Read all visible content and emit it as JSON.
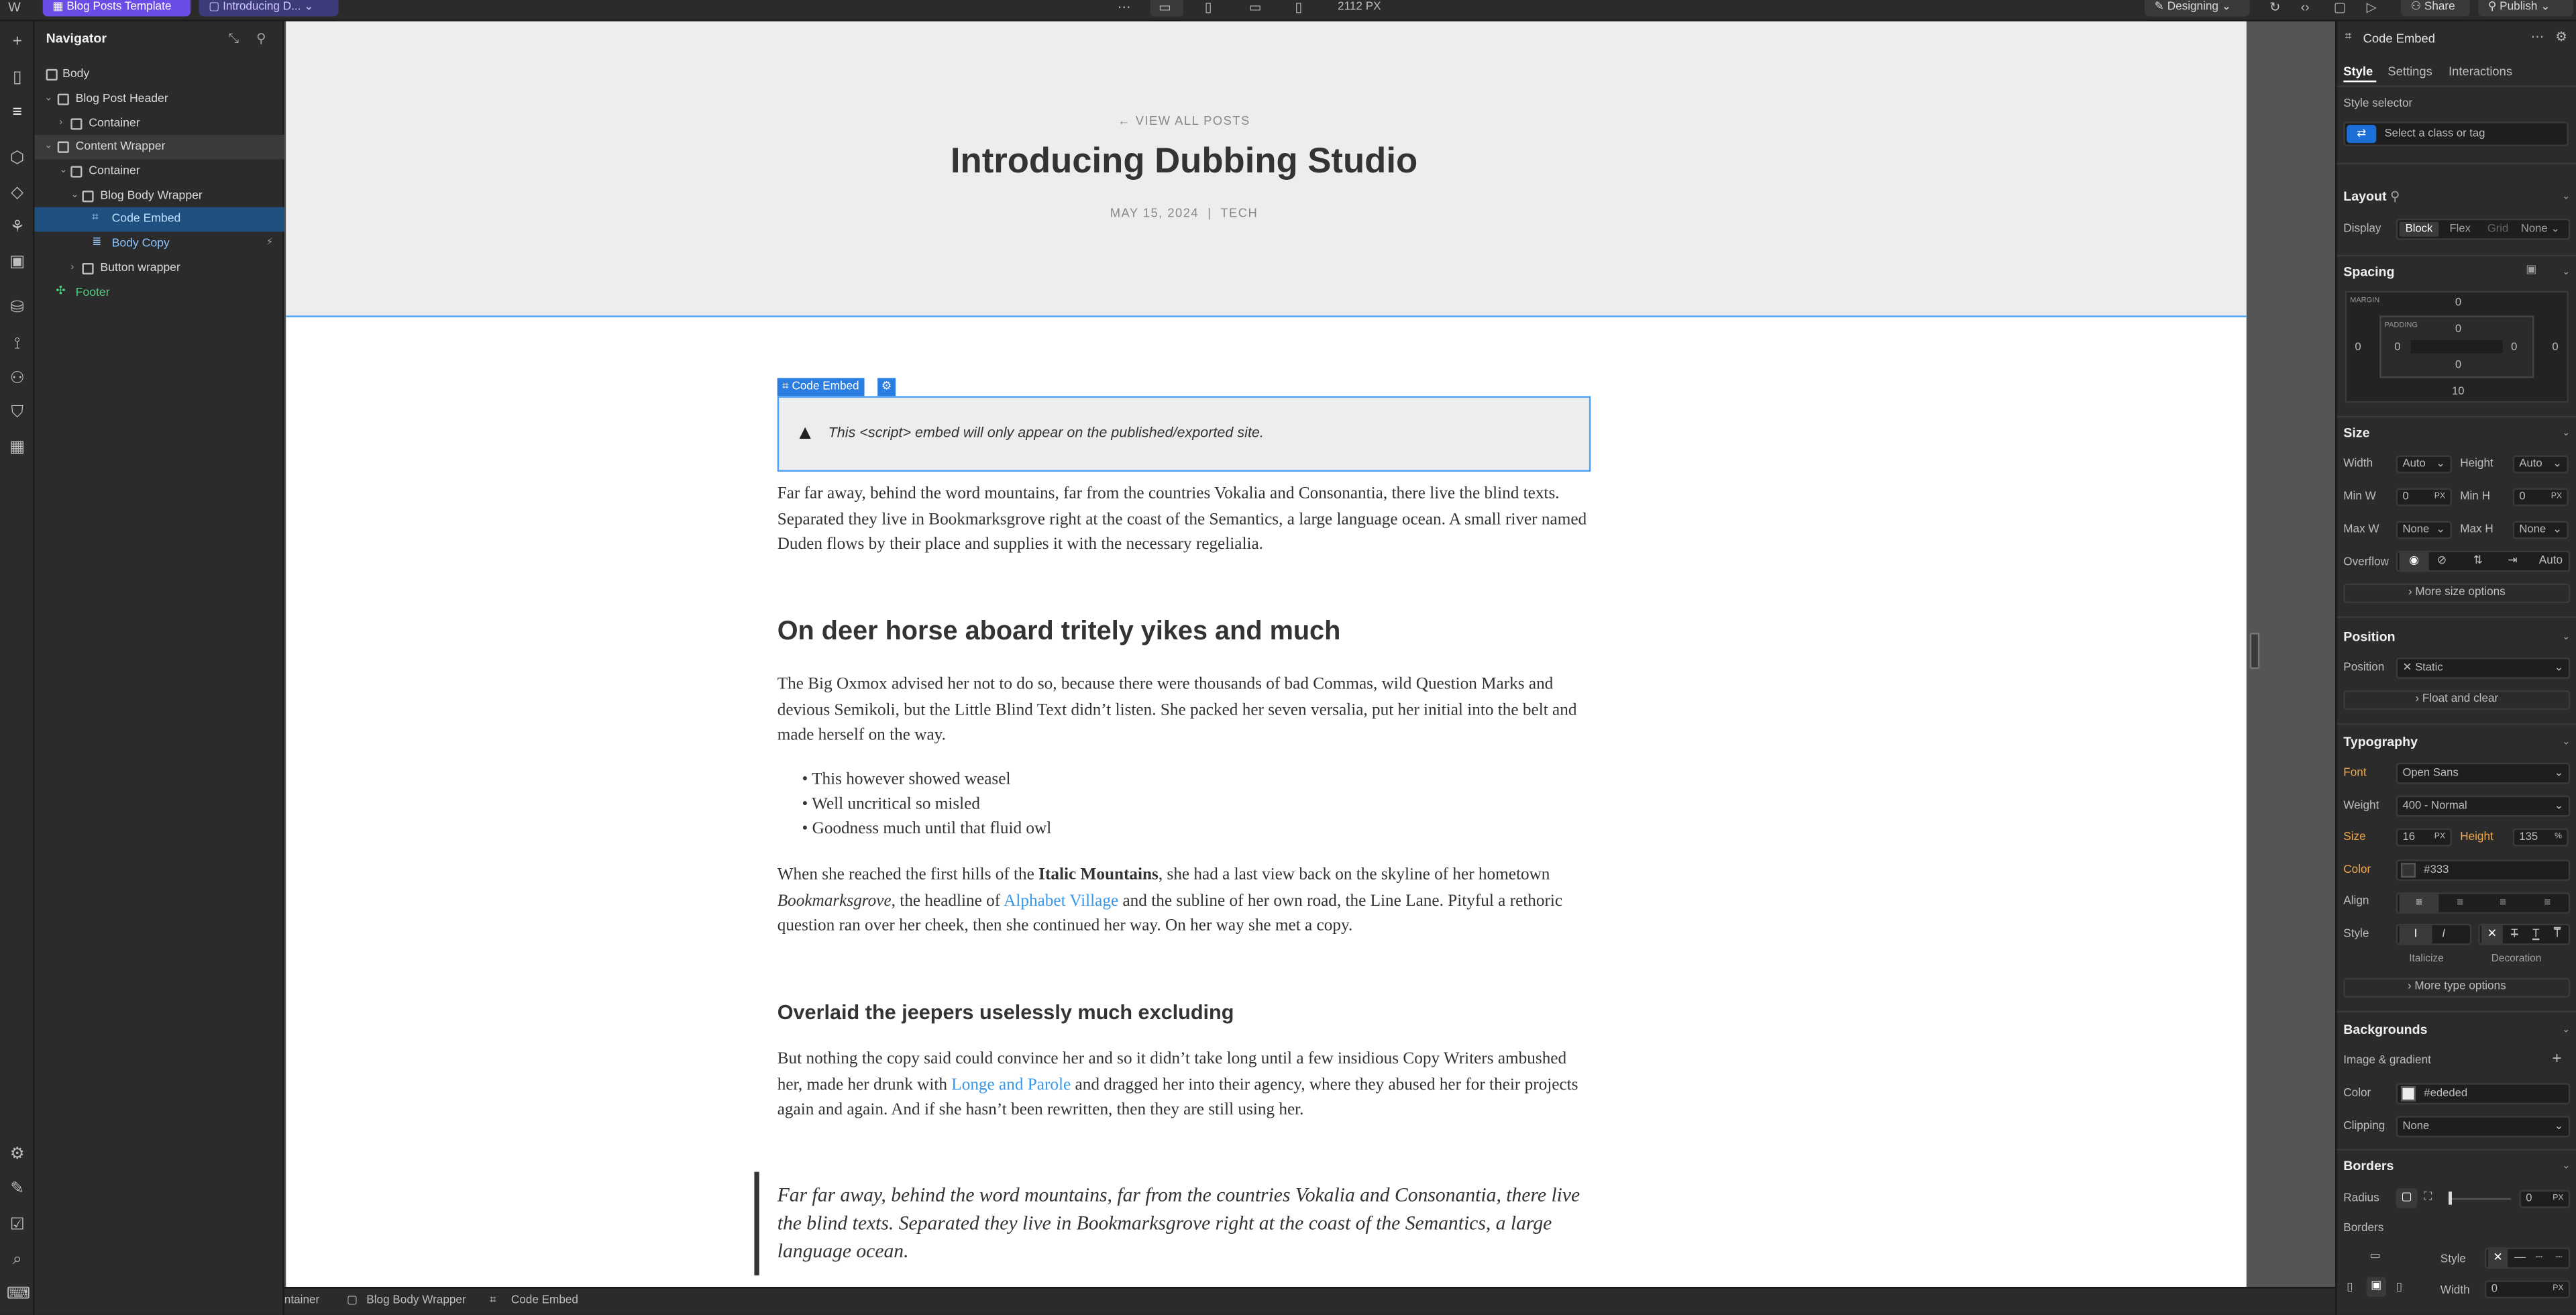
{
  "topbar": {
    "project_label": "Blog Posts Template",
    "page_label": "Introducing D...",
    "canvas_width": "2112 PX",
    "mode_label": "Designing",
    "share_label": "Share",
    "publish_label": "Publish"
  },
  "navigator": {
    "title": "Navigator",
    "items": [
      {
        "label": "Body"
      },
      {
        "label": "Blog Post Header"
      },
      {
        "label": "Container"
      },
      {
        "label": "Content Wrapper"
      },
      {
        "label": "Container"
      },
      {
        "label": "Blog Body Wrapper"
      },
      {
        "label": "Code Embed"
      },
      {
        "label": "Body Copy"
      },
      {
        "label": "Button wrapper"
      },
      {
        "label": "Footer"
      }
    ]
  },
  "page": {
    "back_link": "← VIEW ALL POSTS",
    "title": "Introducing Dubbing Studio",
    "date": "MAY 15, 2024",
    "separator": "|",
    "category": "TECH",
    "embed_tag": "Code Embed",
    "embed_notice": "This <script> embed will only appear on the published/exported site.",
    "para1": "Far far away, behind the word mountains, far from the countries Vokalia and Consonantia, there live the blind texts. Separated they live in Bookmarksgrove right at the coast of the Semantics, a large language ocean. A small river named Duden flows by their place and supplies it with the necessary regelialia.",
    "h2": "On deer horse aboard tritely yikes and much",
    "para2": "The Big Oxmox advised her not to do so, because there were thousands of bad Commas, wild Question Marks and devious Semikoli, but the Little Blind Text didn’t listen. She packed her seven versalia, put her initial into the belt and made herself on the way.",
    "list": [
      "This however showed weasel",
      "Well uncritical so misled",
      "Goodness much until that fluid owl"
    ],
    "para3_a": "When she reached the first hills of the ",
    "para3_b": "Italic Mountains",
    "para3_c": ", she had a last view back on the skyline of her hometown ",
    "para3_d": "Bookmarksgrove",
    "para3_e": ", the headline of ",
    "para3_link": "Alphabet Village",
    "para3_f": " and the subline of her own road, the Line Lane. Pityful a rethoric question ran over her cheek, then she continued her way. On her way she met a copy.",
    "h3": "Overlaid the jeepers uselessly much excluding",
    "para4_a": "But nothing the copy said could convince her and so it didn’t take long until a few insidious Copy Writers ambushed her, made her drunk with ",
    "para4_link": "Longe and Parole",
    "para4_b": " and dragged her into their agency, where they abused her for their projects again and again. And if she hasn’t been rewritten, then they are still using her.",
    "quote": "Far far away, behind the word mountains, far from the countries Vokalia and Consonantia, there live the blind texts. Separated they live in Bookmarksgrove right at the coast of the Semantics, a large language ocean."
  },
  "panel": {
    "element": "Code Embed",
    "tabs": [
      "Style",
      "Settings",
      "Interactions"
    ],
    "style_selector_label": "Style selector",
    "style_selector_placeholder": "Select a class or tag",
    "layout": {
      "title": "Layout",
      "display_label": "Display",
      "options": [
        "Block",
        "Flex",
        "Grid",
        "None"
      ]
    },
    "spacing": {
      "title": "Spacing",
      "margin_label": "MARGIN",
      "padding_label": "PADDING",
      "margin": {
        "top": "0",
        "right": "0",
        "bottom": "10",
        "left": "0"
      },
      "padding": {
        "top": "0",
        "right": "0",
        "bottom": "0",
        "left": "0"
      }
    },
    "size": {
      "title": "Size",
      "width_label": "Width",
      "width": "Auto",
      "height_label": "Height",
      "height": "Auto",
      "minw_label": "Min W",
      "minw": "0",
      "minh_label": "Min H",
      "minh": "0",
      "maxw_label": "Max W",
      "maxw": "None",
      "maxh_label": "Max H",
      "maxh": "None",
      "overflow_label": "Overflow",
      "overflow_auto": "Auto",
      "unit": "PX",
      "more": "More size options"
    },
    "position": {
      "title": "Position",
      "label": "Position",
      "value": "Static",
      "float": "Float and clear"
    },
    "typography": {
      "title": "Typography",
      "font_label": "Font",
      "font": "Open Sans",
      "weight_label": "Weight",
      "weight": "400 - Normal",
      "size_label": "Size",
      "size": "16",
      "size_unit": "PX",
      "height_label": "Height",
      "height": "135",
      "height_unit": "%",
      "color_label": "Color",
      "color": "#333",
      "align_label": "Align",
      "style_label": "Style",
      "italicize": "Italicize",
      "decoration": "Decoration",
      "more": "More type options"
    },
    "backgrounds": {
      "title": "Backgrounds",
      "image_label": "Image & gradient",
      "color_label": "Color",
      "color": "#ededed",
      "clipping_label": "Clipping",
      "clipping": "None"
    },
    "borders": {
      "title": "Borders",
      "radius_label": "Radius",
      "radius": "0",
      "radius_unit": "PX",
      "borders_label": "Borders",
      "style_label": "Style",
      "width_label": "Width",
      "width": "0",
      "width_unit": "PX"
    }
  },
  "breadcrumb": [
    "ntainer",
    "Blog Body Wrapper",
    "Code Embed"
  ],
  "colors": {
    "accent": "#4aa3ff",
    "selection": "#1f4f7f",
    "link": "#3898ec",
    "font_label": "#f0a84a",
    "footer": "#4ccf7c"
  }
}
